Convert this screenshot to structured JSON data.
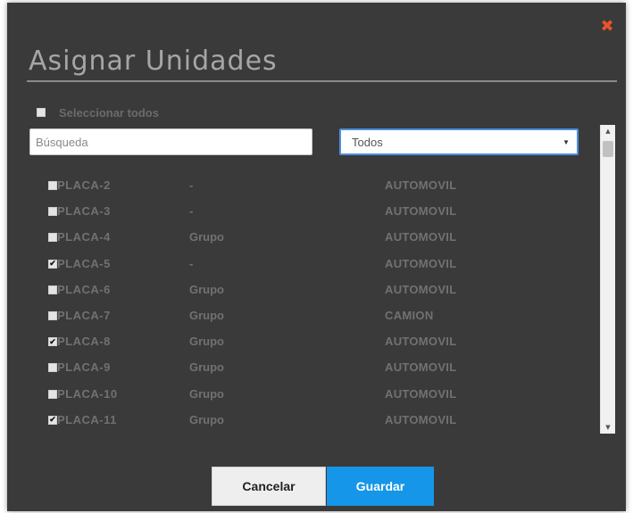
{
  "dialog": {
    "title": "Asignar Unidades",
    "close_icon": "close-x-icon",
    "close_color": "#e8532b"
  },
  "select_all": {
    "label": "Seleccionar todos",
    "checked": false
  },
  "search": {
    "placeholder": "Búsqueda",
    "value": ""
  },
  "filter": {
    "selected": "Todos"
  },
  "units": [
    {
      "placa": "PLACA-2",
      "grupo": "-",
      "tipo": "AUTOMOVIL",
      "checked": false
    },
    {
      "placa": "PLACA-3",
      "grupo": "-",
      "tipo": "AUTOMOVIL",
      "checked": false
    },
    {
      "placa": "PLACA-4",
      "grupo": "Grupo",
      "tipo": "AUTOMOVIL",
      "checked": false
    },
    {
      "placa": "PLACA-5",
      "grupo": "-",
      "tipo": "AUTOMOVIL",
      "checked": true
    },
    {
      "placa": "PLACA-6",
      "grupo": "Grupo",
      "tipo": "AUTOMOVIL",
      "checked": false
    },
    {
      "placa": "PLACA-7",
      "grupo": "Grupo",
      "tipo": "CAMION",
      "checked": false
    },
    {
      "placa": "PLACA-8",
      "grupo": "Grupo",
      "tipo": "AUTOMOVIL",
      "checked": true
    },
    {
      "placa": "PLACA-9",
      "grupo": "Grupo",
      "tipo": "AUTOMOVIL",
      "checked": false
    },
    {
      "placa": "PLACA-10",
      "grupo": "Grupo",
      "tipo": "AUTOMOVIL",
      "checked": false
    },
    {
      "placa": "PLACA-11",
      "grupo": "Grupo",
      "tipo": "AUTOMOVIL",
      "checked": true
    }
  ],
  "buttons": {
    "cancel_label": "Cancelar",
    "save_label": "Guardar"
  },
  "colors": {
    "dialog_bg": "#3a3a3a",
    "accent": "#1596e8",
    "focus_border": "#4e90e0"
  }
}
